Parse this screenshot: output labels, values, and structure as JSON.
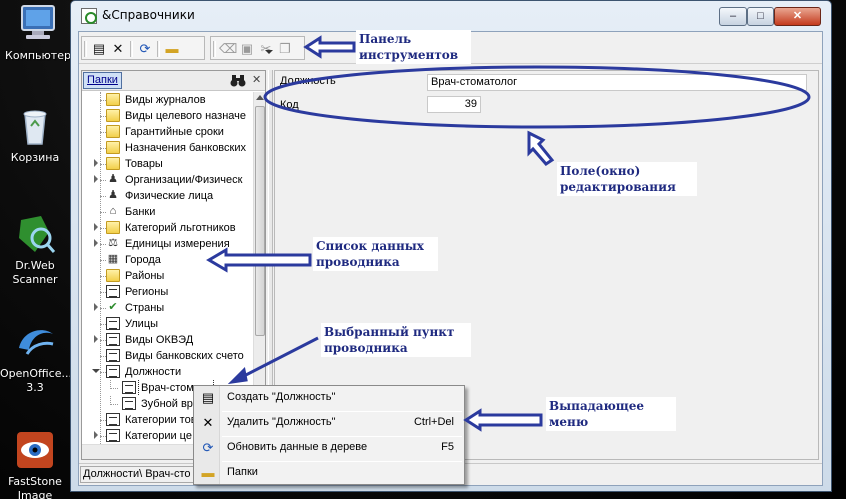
{
  "desktop": {
    "icons": [
      {
        "label": "Компьютер",
        "icon": "computer-icon"
      },
      {
        "label": "Корзина",
        "icon": "recycle-bin-icon"
      },
      {
        "label": "Dr.Web Scanner",
        "icon": "drweb-icon"
      },
      {
        "label": "OpenOffice... 3.3",
        "icon": "openoffice-icon"
      },
      {
        "label": "FastStone Image Viewer",
        "icon": "faststone-icon"
      }
    ]
  },
  "window": {
    "title": "&Справочники",
    "controls": {
      "minimize": "–",
      "maximize": "□",
      "close": "✕"
    }
  },
  "toolbar": {
    "buttons": [
      {
        "name": "new-record",
        "icon": "document-icon",
        "glyph": "▤"
      },
      {
        "name": "delete",
        "icon": "delete-x-icon",
        "glyph": "✕"
      },
      {
        "name": "refresh",
        "icon": "refresh-icon",
        "glyph": "⟳"
      },
      {
        "name": "folders",
        "icon": "folder-icon",
        "glyph": "▬"
      },
      {
        "name": "eraser",
        "icon": "eraser-icon",
        "glyph": "⌫"
      },
      {
        "name": "paste",
        "icon": "paste-icon",
        "glyph": "▣"
      },
      {
        "name": "cut",
        "icon": "cut-icon",
        "glyph": "✂"
      },
      {
        "name": "copy",
        "icon": "copy-icon",
        "glyph": "❐"
      }
    ]
  },
  "left_panel": {
    "tab_label": "Папки",
    "search_icon": "binoculars-icon",
    "close_label": "✕",
    "tree": [
      {
        "label": "Виды журналов",
        "icon": "folder",
        "level": 1
      },
      {
        "label": "Виды целевого назначе",
        "icon": "folder",
        "level": 1
      },
      {
        "label": "Гарантийные сроки",
        "icon": "folder",
        "level": 1
      },
      {
        "label": "Назначения банковских",
        "icon": "folder",
        "level": 1
      },
      {
        "label": "Товары",
        "icon": "folder",
        "level": 1,
        "expandable": true
      },
      {
        "label": "Организации/Физическ",
        "icon": "people",
        "level": 1,
        "expandable": true
      },
      {
        "label": "Физические лица",
        "icon": "people",
        "level": 1
      },
      {
        "label": "Банки",
        "icon": "bank",
        "level": 1
      },
      {
        "label": "Категорий льготников",
        "icon": "folder",
        "level": 1,
        "expandable": true
      },
      {
        "label": "Единицы измерения",
        "icon": "scales",
        "level": 1,
        "expandable": true
      },
      {
        "label": "Города",
        "icon": "city",
        "level": 1
      },
      {
        "label": "Районы",
        "icon": "folder",
        "level": 1
      },
      {
        "label": "Регионы",
        "icon": "doc",
        "level": 1
      },
      {
        "label": "Страны",
        "icon": "check",
        "level": 1,
        "expandable": true
      },
      {
        "label": "Улицы",
        "icon": "doc",
        "level": 1
      },
      {
        "label": "Виды ОКВЭД",
        "icon": "doc",
        "level": 1,
        "expandable": true
      },
      {
        "label": "Виды банковских счето",
        "icon": "doc",
        "level": 1
      },
      {
        "label": "Должности",
        "icon": "doc",
        "level": 1,
        "expanded": true
      },
      {
        "label": "Врач-стомато",
        "icon": "doc",
        "level": 2,
        "selected": true
      },
      {
        "label": "Зубной вр",
        "icon": "doc",
        "level": 2
      },
      {
        "label": "Категории тов",
        "icon": "doc",
        "level": 1
      },
      {
        "label": "Категории це",
        "icon": "doc",
        "level": 1,
        "expandable": true
      }
    ]
  },
  "edit_panel": {
    "fields": [
      {
        "label": "Должность",
        "value": "Врач-стоматолог"
      },
      {
        "label": "Код",
        "value": "39"
      }
    ]
  },
  "status_bar": {
    "path": "Должности\\ Врач-сто"
  },
  "context_menu": {
    "items": [
      {
        "label": "Создать \"Должность\"",
        "icon": "document-icon",
        "glyph": "▤",
        "shortcut": ""
      },
      {
        "label": "Удалить \"Должность\"",
        "icon": "delete-x-icon",
        "glyph": "✕",
        "shortcut": "Ctrl+Del"
      },
      {
        "label": "Обновить данные в дереве",
        "icon": "refresh-icon",
        "glyph": "⟳",
        "shortcut": "F5"
      },
      {
        "label": "Папки",
        "icon": "folder-icon",
        "glyph": "▬",
        "shortcut": ""
      }
    ]
  },
  "annotations": {
    "toolbar": "Панель инструментов",
    "editor": "Поле(окно) редактирования",
    "tree_list": "Список данных проводника",
    "selected_item": "Выбранный пункт проводника",
    "dropdown": "Выпадающее меню"
  },
  "colors": {
    "annotation": "#2b3a9e",
    "annotation_text": "#1f2a80",
    "selection_tab": "#cfe0f6"
  }
}
